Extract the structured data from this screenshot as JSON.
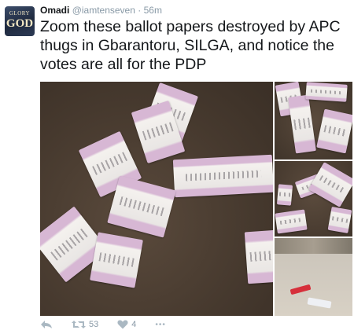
{
  "user": {
    "name": "Omadi",
    "handle": "@iamtenseven",
    "time": "56m",
    "separator": "·"
  },
  "avatar": {
    "label_top": "GLORY",
    "label_main": "GOD"
  },
  "tweet": {
    "text": "Zoom these ballot papers destroyed by APC thugs in Gbarantoru, SILGA, and notice the votes are all for the PDP"
  },
  "actions": {
    "reply": {
      "icon": "reply-icon"
    },
    "retweet": {
      "icon": "retweet-icon",
      "count": "53"
    },
    "like": {
      "icon": "heart-icon",
      "count": "4"
    },
    "more": {
      "icon": "more-icon",
      "label": "•••"
    }
  },
  "colors": {
    "text": "#14171a",
    "muted": "#8899a6",
    "ballot_stripe": "#d7b7d4"
  }
}
